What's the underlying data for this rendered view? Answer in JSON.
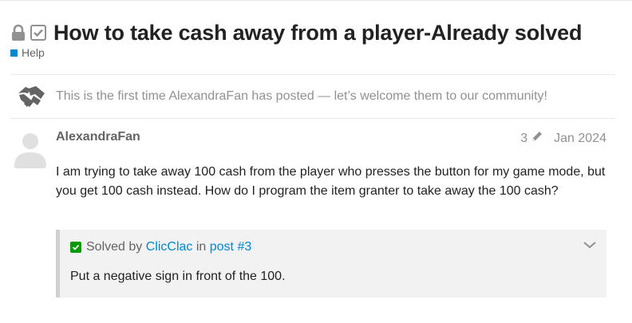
{
  "topic": {
    "title": "How to take cash away from a player-Already solved",
    "status_icons": [
      "lock-icon",
      "checkbox-icon"
    ],
    "category": {
      "label": "Help",
      "color": "#0088cc"
    }
  },
  "welcome_notice": {
    "icon": "handshake-icon",
    "text": "This is the first time AlexandraFan has posted — let’s welcome them to our community!"
  },
  "post": {
    "username": "AlexandraFan",
    "edit_count": "3",
    "date": "Jan 2024",
    "body": "I am trying to take away 100 cash from the player who presses the button for my game mode, but you get 100 cash instead. How do I program the item granter to take away the 100 cash?"
  },
  "solution": {
    "solved_by_label": "Solved by",
    "author": "ClicClac",
    "in_label": "in",
    "post_link": "post #3",
    "text": "Put a negative sign in front of the 100.",
    "accent_color": "#009900"
  },
  "colors": {
    "text_primary": "#222222",
    "text_muted": "#919191",
    "link": "#0088cc",
    "quote_bg": "#f2f2f2"
  }
}
